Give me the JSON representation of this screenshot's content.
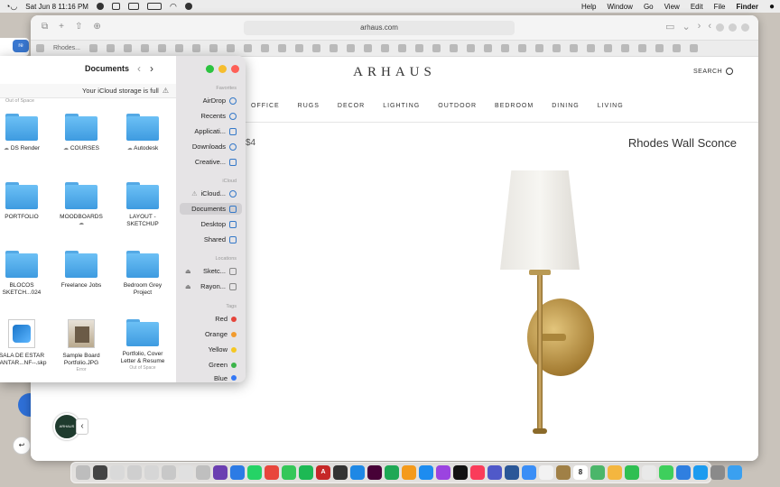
{
  "menubar": {
    "app_name": "Finder",
    "menus": [
      "File",
      "Edit",
      "View",
      "Go",
      "Window",
      "Help"
    ],
    "datetime": "Sat Jun 8  11:16 PM"
  },
  "browser": {
    "url": "arhaus.com",
    "tab_title": "Rhodes..."
  },
  "page": {
    "logo": "ARHAUS",
    "search_label": "SEARCH",
    "nav": [
      "LIVING",
      "DINING",
      "BEDROOM",
      "OUTDOOR",
      "LIGHTING",
      "DECOR",
      "RUGS",
      "OFFICE"
    ],
    "product_title": "Rhodes Wall Sconce",
    "price": "$4",
    "chat_label": "ARHAUS",
    "collapse_icon": "‹"
  },
  "finder": {
    "title": "Documents",
    "storage_warning": "Your iCloud storage is full",
    "top_caption": "Out of Space",
    "items": [
      {
        "name": "Autodesk",
        "kind": "folder",
        "status": "cloud"
      },
      {
        "name": "COURSES",
        "kind": "folder",
        "status": "cloud"
      },
      {
        "name": "DS Render",
        "kind": "folder",
        "status": "cloud"
      },
      {
        "name": "LAYOUT - SKETCHUP",
        "kind": "folder",
        "status": ""
      },
      {
        "name": "MOODBOARDS",
        "kind": "folder",
        "status": "cloud"
      },
      {
        "name": "PORTFOLIO",
        "kind": "folder",
        "status": ""
      },
      {
        "name": "Bedroom Grey Project",
        "kind": "folder",
        "status": ""
      },
      {
        "name": "Freelance Jobs",
        "kind": "folder",
        "status": ""
      },
      {
        "name": "BLOCOS SKETCH...024",
        "kind": "folder",
        "status": ""
      },
      {
        "name": "Portfolio, Cover Letter & Resume",
        "kind": "folder",
        "status": "Out of Space"
      },
      {
        "name": "Sample Board Portfolio.JPG",
        "kind": "photo",
        "status": "Error"
      },
      {
        "name": "SALA DE ESTAR JANTAR...NF--.skp",
        "kind": "doc",
        "status": ""
      }
    ],
    "sidebar": {
      "favorites_label": "Favorites",
      "favorites": [
        "AirDrop",
        "Recents",
        "Applicati...",
        "Downloads",
        "Creative..."
      ],
      "icloud_label": "iCloud",
      "icloud": [
        "iCloud...",
        "Documents",
        "Desktop",
        "Shared"
      ],
      "locations_label": "Locations",
      "locations": [
        "Sketc...",
        "Rayon..."
      ],
      "tags_label": "Tags",
      "tags": [
        {
          "name": "Red",
          "color": "#e5443b"
        },
        {
          "name": "Orange",
          "color": "#f29b2e"
        },
        {
          "name": "Yellow",
          "color": "#f5c723"
        },
        {
          "name": "Green",
          "color": "#3cb44a"
        },
        {
          "name": "Blue",
          "color": "#3478f6"
        }
      ]
    }
  },
  "edge": {
    "pill_label": "re"
  },
  "dock": {
    "calendar_day": "8",
    "apps": [
      "trash",
      "downloads",
      "files",
      "files",
      "files",
      "files",
      "files",
      "safari",
      "appstore",
      "facetime",
      "spotify",
      "autocad",
      "chatgpt",
      "appstore",
      "xd",
      "numbers",
      "pages",
      "podcasts",
      "tv",
      "music",
      "teams",
      "word",
      "mail",
      "reminders",
      "calendar",
      "photos",
      "messages",
      "notes",
      "launchpad",
      "finder"
    ]
  },
  "colors": {
    "folder_blue": "#4aa8ec",
    "selection": "#d2d0d3",
    "brass": "#b99a55"
  }
}
